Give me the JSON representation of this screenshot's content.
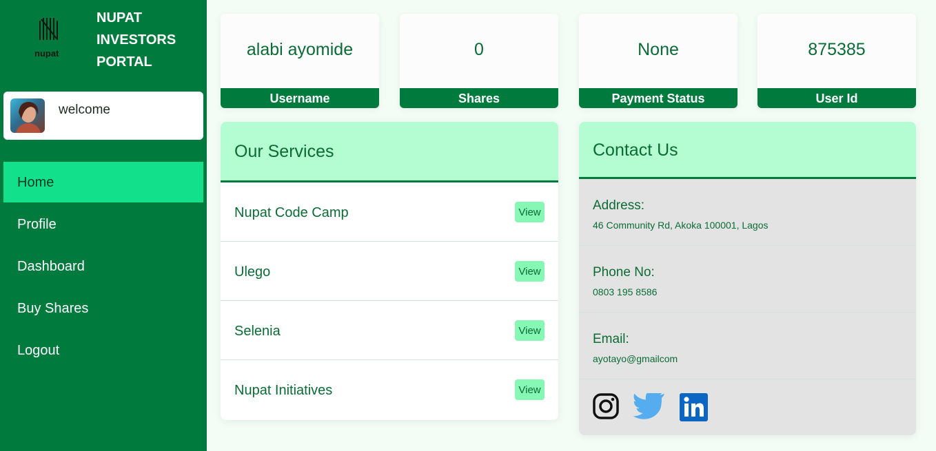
{
  "brand": {
    "logo_word": "nupat",
    "portal_title": "NUPAT INVESTORS PORTAL"
  },
  "welcome": {
    "text": "welcome"
  },
  "nav": [
    {
      "label": "Home",
      "active": true
    },
    {
      "label": "Profile"
    },
    {
      "label": "Dashboard"
    },
    {
      "label": "Buy Shares"
    },
    {
      "label": "Logout"
    }
  ],
  "stats": [
    {
      "value": "alabi ayomide",
      "label": "Username"
    },
    {
      "value": "0",
      "label": "Shares"
    },
    {
      "value": "None",
      "label": "Payment Status"
    },
    {
      "value": "875385",
      "label": "User Id"
    }
  ],
  "services": {
    "title": "Our Services",
    "items": [
      {
        "name": "Nupat Code Camp",
        "action": "View"
      },
      {
        "name": "Ulego",
        "action": "View"
      },
      {
        "name": "Selenia",
        "action": "View"
      },
      {
        "name": "Nupat Initiatives",
        "action": "View"
      }
    ]
  },
  "contact": {
    "title": "Contact Us",
    "address_label": "Address:",
    "address": "46 Community Rd, Akoka 100001, Lagos",
    "phone_label": "Phone No:",
    "phone": "0803 195 8586",
    "email_label": "Email:",
    "email": "ayotayo@gmailcom",
    "socials": [
      "instagram-icon",
      "twitter-icon",
      "linkedin-icon"
    ]
  },
  "colors": {
    "sidebar": "#017a3e",
    "nav_active": "#13e08a",
    "panel_header": "#b4fdd2",
    "text_green": "#0b6b36",
    "view_button": "#86f7b4"
  }
}
